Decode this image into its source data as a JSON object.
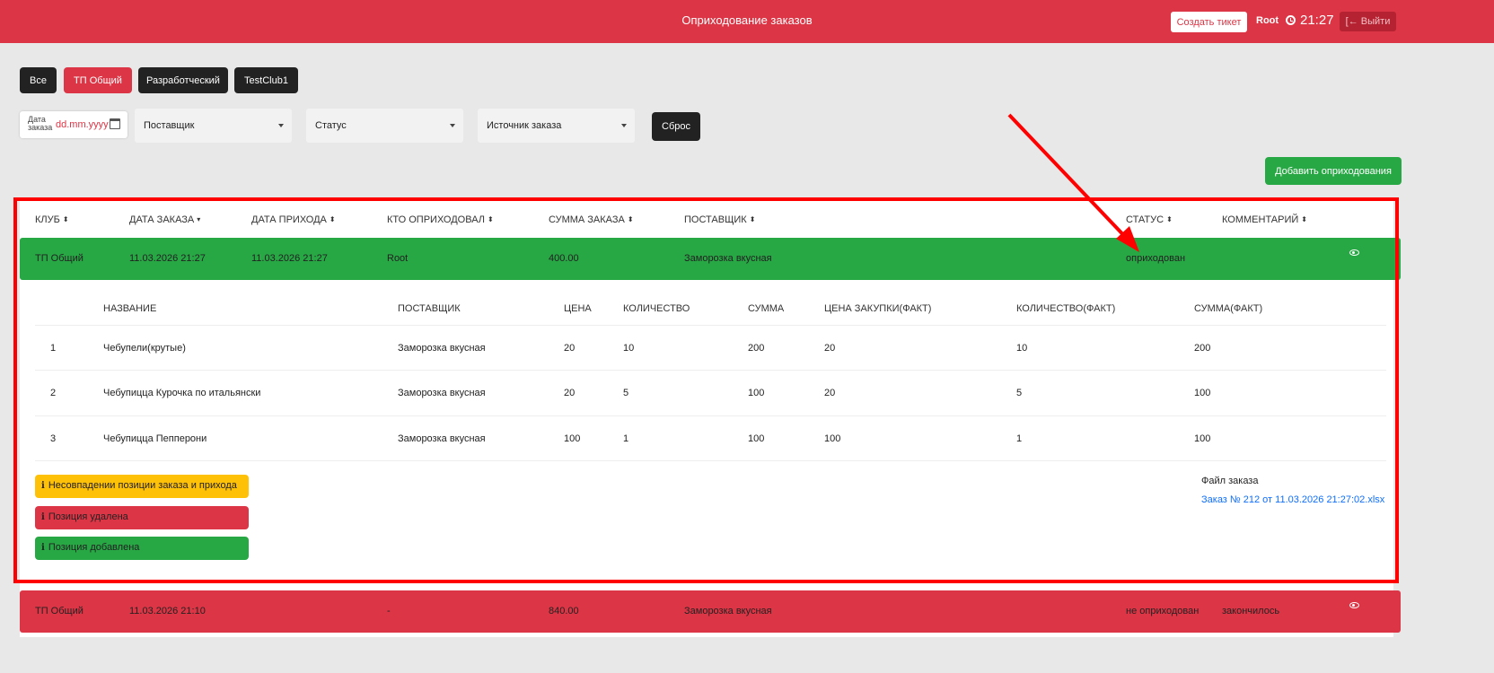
{
  "header": {
    "title": "Оприходование заказов",
    "create_ticket_label": "Создать тикет",
    "user": "Root",
    "time": "21:27",
    "exit_label": "Выйти"
  },
  "club_tabs": [
    {
      "label": "Все",
      "active": false
    },
    {
      "label": "ТП Общий",
      "active": true
    },
    {
      "label": "Разработческий",
      "active": false
    },
    {
      "label": "TestClub1",
      "active": false
    }
  ],
  "filters": {
    "date_label": "Дата заказа",
    "date_value": "dd.mm.yyyy",
    "supplier": "Поставщик",
    "status": "Статус",
    "source": "Источник заказа",
    "reset_label": "Сброс"
  },
  "add_button_label": "Добавить оприходования",
  "table": {
    "columns": [
      "КЛУБ",
      "ДАТА ЗАКАЗА",
      "ДАТА ПРИХОДА",
      "КТО ОПРИХОДОВАЛ",
      "СУММА ЗАКАЗА",
      "ПОСТАВЩИК",
      "СТАТУС",
      "КОММЕНТАРИЙ"
    ],
    "rows": [
      {
        "club": "ТП Общий",
        "order_date": "11.03.2026 21:27",
        "arrival_date": "11.03.2026 21:27",
        "who": "Root",
        "sum": "400.00",
        "supplier": "Заморозка вкусная",
        "status": "оприходован",
        "comment": "",
        "color": "#28a745"
      },
      {
        "club": "ТП Общий",
        "order_date": "11.03.2026 21:10",
        "arrival_date": "",
        "who": "-",
        "sum": "840.00",
        "supplier": "Заморозка вкусная",
        "status": "не оприходован",
        "comment": "закончилось",
        "color": "#dc3545"
      }
    ]
  },
  "details": {
    "columns": [
      "НАЗВАНИЕ",
      "ПОСТАВЩИК",
      "ЦЕНА",
      "КОЛИЧЕСТВО",
      "СУММА",
      "ЦЕНА ЗАКУПКИ(ФАКТ)",
      "КОЛИЧЕСТВО(ФАКТ)",
      "СУММА(ФАКТ)"
    ],
    "items": [
      {
        "n": "1",
        "name": "Чебупели(крутые)",
        "supplier": "Заморозка вкусная",
        "price": "20",
        "qty": "10",
        "sum": "200",
        "price_fact": "20",
        "qty_fact": "10",
        "sum_fact": "200"
      },
      {
        "n": "2",
        "name": "Чебупицца Курочка по итальянски",
        "supplier": "Заморозка вкусная",
        "price": "20",
        "qty": "5",
        "sum": "100",
        "price_fact": "20",
        "qty_fact": "5",
        "sum_fact": "100"
      },
      {
        "n": "3",
        "name": "Чебупицца Пепперони",
        "supplier": "Заморозка вкусная",
        "price": "100",
        "qty": "1",
        "sum": "100",
        "price_fact": "100",
        "qty_fact": "1",
        "sum_fact": "100"
      }
    ],
    "legend": [
      {
        "label": "Несовпадении позиции заказа и прихода",
        "color": "#ffc107"
      },
      {
        "label": "Позиция удалена",
        "color": "#dc3545"
      },
      {
        "label": "Позиция добавлена",
        "color": "#28a745"
      }
    ],
    "file_label": "Файл заказа",
    "file_link": "Заказ № 212 от 11.03.2026 21:27:02.xlsx"
  },
  "colors": {
    "header_bg": "#dc3545",
    "active_tab": "#dc3545",
    "tab": "#222222",
    "add_button": "#28a745",
    "annotation": "#ff0000"
  }
}
